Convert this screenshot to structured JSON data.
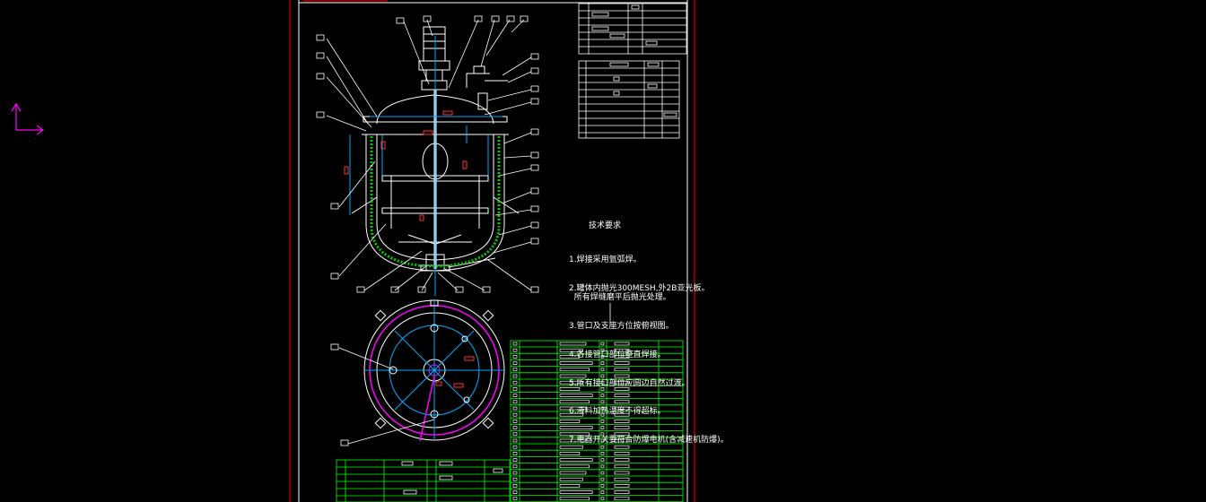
{
  "notes": {
    "title": "技术要求",
    "items": [
      "1.焊接采用氩弧焊。",
      "2.罐体内抛光300MESH,外2B亚光板。\n  所有焊缝磨平后抛光处理。",
      "3.管口及支座方位按俯视图。",
      "4.各接管口部位整直焊接。",
      "5.所有接口部位应圆边自然过渡。",
      "6.液料加热温度不得超标。",
      "7.电器开关要符合防爆电机(含减速机防爆)。"
    ]
  },
  "colors": {
    "background": "#000000",
    "frame": "#ff0000",
    "outline": "#ffffff",
    "centerline": "#00aaff",
    "insulation": "#00cc00",
    "table": "#00ff00",
    "highlight": "#ff00ff",
    "label_box": "#ff3030"
  }
}
